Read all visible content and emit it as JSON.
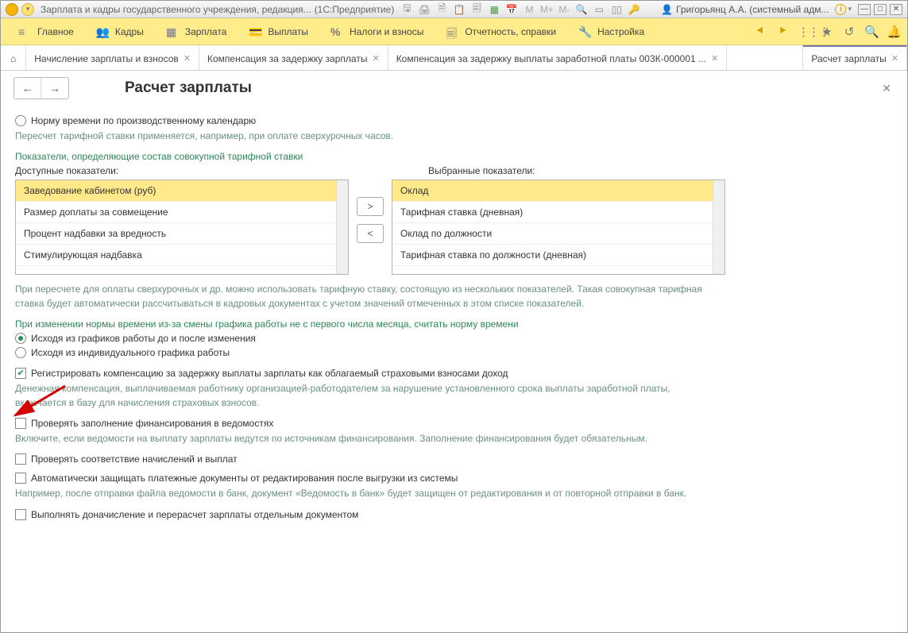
{
  "titlebar": {
    "app_title": "Зарплата и кадры государственного учреждения, редакция...",
    "platform": "(1С:Предприятие)",
    "user_label": "Григорьянц А.А. (системный адм..."
  },
  "mainmenu": {
    "items": [
      {
        "icon": "≡",
        "label": "Главное"
      },
      {
        "icon": "👥",
        "label": "Кадры"
      },
      {
        "icon": "▦",
        "label": "Зарплата"
      },
      {
        "icon": "💳",
        "label": "Выплаты"
      },
      {
        "icon": "%",
        "label": "Налоги и взносы"
      },
      {
        "icon": "🗐",
        "label": "Отчетность, справки"
      },
      {
        "icon": "🔧",
        "label": "Настройка"
      }
    ]
  },
  "tabs": {
    "items": [
      {
        "label": "Начисление зарплаты и взносов"
      },
      {
        "label": "Компенсация за задержку зарплаты"
      },
      {
        "label": "Компенсация за задержку выплаты заработной платы 003К-000001 ..."
      },
      {
        "label": "Расчет зарплаты",
        "active": true
      }
    ]
  },
  "header": {
    "title": "Расчет зарплаты"
  },
  "body": {
    "radio_norm": "Норму времени по производственному календарю",
    "hint_recalc": "Пересчет тарифной ставки применяется, например, при оплате сверхурочных часов.",
    "section_indicators": "Показатели, определяющие состав совокупной тарифной ставки",
    "label_available": "Доступные показатели:",
    "label_selected": "Выбранные показатели:",
    "available": [
      "Заведование кабинетом (руб)",
      "Размер доплаты за совмещение",
      "Процент надбавки за вредность",
      "Стимулирующая надбавка"
    ],
    "selected": [
      "Оклад",
      "Тарифная ставка (дневная)",
      "Оклад по должности",
      "Тарифная ставка по должности (дневная)"
    ],
    "move_right": ">",
    "move_left": "<",
    "para_overtime": "При пересчете для оплаты сверхурочных и др. можно использовать тарифную ставку, состоящую из нескольких показателей. Такая совокупная тарифная ставка будет автоматически рассчитываться в кадровых документах с учетом значений отмеченных в этом списке показателей.",
    "section_norm_change": "При изменении нормы времени из-за смены графика работы не с первого числа месяца, считать норму времени",
    "radio_graph_before_after": "Исходя из графиков работы до и после изменения",
    "radio_individual": "Исходя из индивидуального графика работы",
    "chk_compensation": "Регистрировать компенсацию за задержку выплаты зарплаты как облагаемый страховыми взносами доход",
    "hint_compensation": "Денежная компенсация, выплачиваемая работнику организацией-работодателем за нарушение установленного срока выплаты заработной платы, включается в базу для начисления страховых взносов.",
    "chk_financing": "Проверять заполнение финансирования в ведомостях",
    "hint_financing": "Включите, если ведомости на выплату зарплаты ведутся по источникам финансирования. Заполнение финансирования будет обязательным.",
    "chk_match": "Проверять соответствие начислений и выплат",
    "chk_protect": "Автоматически защищать платежные документы от редактирования после выгрузки из системы",
    "hint_protect": "Например, после отправки файла ведомости в банк, документ «Ведомость в банк» будет защищен от редактирования и от повторной отправки в банк.",
    "chk_recalc_doc": "Выполнять доначисление и перерасчет зарплаты отдельным документом"
  }
}
